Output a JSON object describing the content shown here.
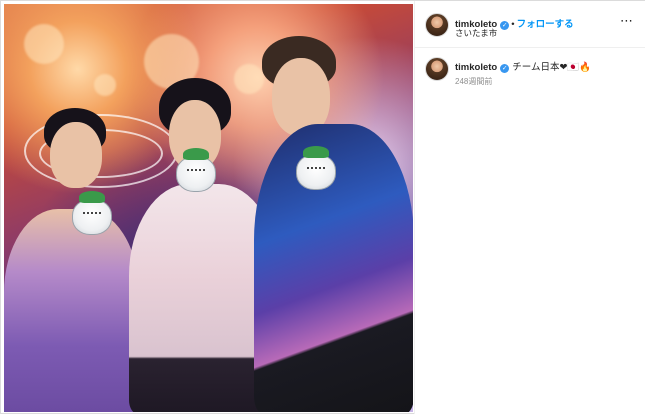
{
  "post": {
    "username": "timkoleto",
    "follow_label": "フォローする",
    "separator": "•",
    "location": "さいたま市",
    "more_icon": "⋯",
    "verified_icon": "✓"
  },
  "caption": {
    "username": "timkoleto",
    "text": "チーム日本❤🇯🇵🔥",
    "time": "248週間前"
  },
  "photo": {
    "description_icon": "photo-image"
  },
  "colors": {
    "accent": "#0095f6",
    "verified": "#3897f0",
    "muted": "#8e8e8e",
    "text": "#262626"
  }
}
